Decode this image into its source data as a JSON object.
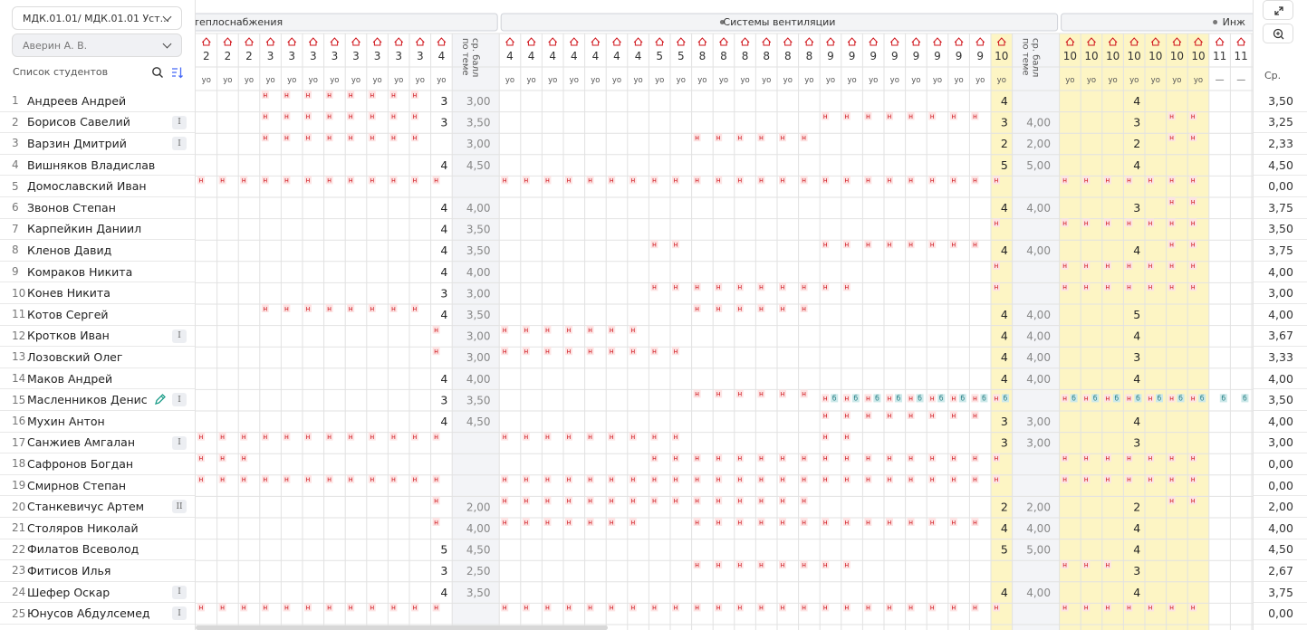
{
  "discipline_select": "МДК.01.01/ МДК.01.01 Уст...",
  "teacher_select": "Аверин А. В.",
  "students_list_title": "Список студентов",
  "average_title": "Ср.",
  "avg_column_label": "ср. балл по теме",
  "mark_absent": "н",
  "mark_sick": "б",
  "lesson_type": "уо",
  "dash": "—",
  "colors": {
    "highlight": "#fdf5c4",
    "absent_bg": "#fde4e4",
    "absent_fg": "#d0141b",
    "sick_bg": "#cde9ea",
    "sick_fg": "#1f7a80",
    "avg_col_bg": "#f3f4f7",
    "grid_line": "#e2e2e2"
  },
  "topics": [
    {
      "title": "темы теплоснабжения",
      "dot": false
    },
    {
      "title": "Системы вентиляции",
      "dot": true
    },
    {
      "title": "Инж",
      "dot": true
    }
  ],
  "columns": [
    "2",
    "2",
    "2",
    "3",
    "3",
    "3",
    "3",
    "3",
    "3",
    "3",
    "3",
    "4",
    "AVG",
    "4",
    "4",
    "4",
    "4",
    "4",
    "4",
    "4",
    "5",
    "5",
    "8",
    "8",
    "8",
    "8",
    "8",
    "8",
    "9",
    "9",
    "9",
    "9",
    "9",
    "9",
    "9",
    "9",
    "10",
    "AVG",
    "10",
    "10",
    "10",
    "10",
    "10",
    "10",
    "10",
    "11",
    "11"
  ],
  "students": [
    {
      "n": "1",
      "name": "Андреев Андрей",
      "badge": "",
      "pen": false,
      "avg": "3,50",
      "t1": {
        "h": "3-10",
        "g": {
          "11": "3"
        },
        "avg": "3,00"
      },
      "t2": {
        "h": "",
        "g": {
          "23": "4"
        },
        "avg": ""
      },
      "t3": {
        "h": "",
        "g": {
          "3": "4"
        }
      }
    },
    {
      "n": "2",
      "name": "Борисов Савелий",
      "badge": "I",
      "pen": false,
      "avg": "3,25",
      "t1": {
        "h": "3-10",
        "g": {
          "11": "3"
        },
        "avg": "3,50"
      },
      "t2": {
        "h": "15-22",
        "g": {
          "23": "3"
        },
        "avg": "4,00"
      },
      "t3": {
        "h": "5-6",
        "g": {
          "3": "3"
        }
      }
    },
    {
      "n": "3",
      "name": "Варзин Дмитрий",
      "badge": "I",
      "pen": false,
      "avg": "2,33",
      "t1": {
        "h": "3-10",
        "g": {},
        "avg": "3,00"
      },
      "t2": {
        "h": "9-14",
        "g": {
          "23": "2"
        },
        "avg": "2,00"
      },
      "t3": {
        "h": "5-6",
        "g": {
          "3": "2"
        }
      }
    },
    {
      "n": "4",
      "name": "Вишняков Владислав",
      "badge": "",
      "pen": false,
      "avg": "4,50",
      "t1": {
        "h": "",
        "g": {
          "11": "4"
        },
        "avg": "4,50"
      },
      "t2": {
        "h": "",
        "g": {
          "23": "5"
        },
        "avg": "5,00"
      },
      "t3": {
        "h": "",
        "g": {
          "3": "4"
        }
      }
    },
    {
      "n": "5",
      "name": "Домославский Иван",
      "badge": "",
      "pen": false,
      "avg": "0,00",
      "t1": {
        "h": "0-11",
        "g": {},
        "avg": ""
      },
      "t2": {
        "h": "0-23",
        "g": {},
        "avg": ""
      },
      "t3": {
        "h": "0-6",
        "g": {}
      }
    },
    {
      "n": "6",
      "name": "Звонов Степан",
      "badge": "",
      "pen": false,
      "avg": "3,75",
      "t1": {
        "h": "",
        "g": {
          "11": "4"
        },
        "avg": "4,00"
      },
      "t2": {
        "h": "",
        "g": {
          "23": "4"
        },
        "avg": "4,00"
      },
      "t3": {
        "h": "5-6",
        "g": {
          "3": "3"
        }
      }
    },
    {
      "n": "7",
      "name": "Карпейкин Даниил",
      "badge": "",
      "pen": false,
      "avg": "3,50",
      "t1": {
        "h": "",
        "g": {
          "11": "4"
        },
        "avg": "3,50"
      },
      "t2": {
        "h": "23",
        "g": {},
        "avg": ""
      },
      "t3": {
        "h": "0-6",
        "g": {}
      }
    },
    {
      "n": "8",
      "name": "Кленов Давид",
      "badge": "",
      "pen": false,
      "avg": "3,75",
      "t1": {
        "h": "",
        "g": {
          "11": "4"
        },
        "avg": "3,50"
      },
      "t2": {
        "h": "7-8,15-22",
        "g": {
          "23": "4"
        },
        "avg": "4,00"
      },
      "t3": {
        "h": "5-6",
        "g": {
          "3": "4"
        }
      }
    },
    {
      "n": "9",
      "name": "Комраков Никита",
      "badge": "",
      "pen": false,
      "avg": "4,00",
      "t1": {
        "h": "",
        "g": {
          "11": "4"
        },
        "avg": "4,00"
      },
      "t2": {
        "h": "23",
        "g": {},
        "avg": ""
      },
      "t3": {
        "h": "0-6",
        "g": {}
      }
    },
    {
      "n": "10",
      "name": "Конев Никита",
      "badge": "",
      "pen": false,
      "avg": "3,00",
      "t1": {
        "h": "",
        "g": {
          "11": "3"
        },
        "avg": "3,00"
      },
      "t2": {
        "h": "7-16,23",
        "g": {},
        "avg": ""
      },
      "t3": {
        "h": "0-6",
        "g": {}
      }
    },
    {
      "n": "11",
      "name": "Котов Сергей",
      "badge": "",
      "pen": false,
      "avg": "4,00",
      "t1": {
        "h": "3-10",
        "g": {
          "11": "4"
        },
        "avg": "3,50"
      },
      "t2": {
        "h": "9-14",
        "g": {
          "23": "4"
        },
        "avg": "4,00"
      },
      "t3": {
        "h": "",
        "g": {
          "3": "5"
        }
      }
    },
    {
      "n": "12",
      "name": "Кротков Иван",
      "badge": "I",
      "pen": false,
      "avg": "3,67",
      "t1": {
        "h": "11",
        "g": {},
        "avg": "3,00"
      },
      "t2": {
        "h": "0-6",
        "g": {
          "23": "4"
        },
        "avg": "4,00"
      },
      "t3": {
        "h": "",
        "g": {
          "3": "4"
        }
      }
    },
    {
      "n": "13",
      "name": "Лозовский Олег",
      "badge": "",
      "pen": false,
      "avg": "3,33",
      "t1": {
        "h": "11",
        "g": {},
        "avg": "3,00"
      },
      "t2": {
        "h": "0-8",
        "g": {
          "23": "4"
        },
        "avg": "4,00"
      },
      "t3": {
        "h": "",
        "g": {
          "3": "3"
        }
      }
    },
    {
      "n": "14",
      "name": "Маков Андрей",
      "badge": "",
      "pen": false,
      "avg": "4,00",
      "t1": {
        "h": "",
        "g": {
          "11": "4"
        },
        "avg": "4,00"
      },
      "t2": {
        "h": "",
        "g": {
          "23": "4"
        },
        "avg": "4,00"
      },
      "t3": {
        "h": "",
        "g": {
          "3": "4"
        }
      }
    },
    {
      "n": "15",
      "name": "Масленников Денис",
      "badge": "I",
      "pen": true,
      "avg": "3,50",
      "t1": {
        "h": "",
        "g": {
          "11": "3"
        },
        "avg": "3,50"
      },
      "t2": {
        "h": "9-14",
        "hb": "15-23",
        "g": {},
        "avg": ""
      },
      "t3": {
        "h": "",
        "hb": "0-6",
        "b": "7-8",
        "g": {}
      }
    },
    {
      "n": "16",
      "name": "Мухин Антон",
      "badge": "",
      "pen": false,
      "avg": "4,00",
      "t1": {
        "h": "",
        "g": {
          "11": "4"
        },
        "avg": "4,50"
      },
      "t2": {
        "h": "15-22",
        "g": {
          "23": "3"
        },
        "avg": "3,00"
      },
      "t3": {
        "h": "",
        "g": {
          "3": "4"
        }
      }
    },
    {
      "n": "17",
      "name": "Санжиев Амгалан",
      "badge": "I",
      "pen": false,
      "avg": "3,00",
      "t1": {
        "h": "0-11",
        "g": {},
        "avg": ""
      },
      "t2": {
        "h": "0-8,15-16",
        "g": {
          "23": "3"
        },
        "avg": "3,00"
      },
      "t3": {
        "h": "",
        "g": {
          "3": "3"
        }
      }
    },
    {
      "n": "18",
      "name": "Сафронов Богдан",
      "badge": "",
      "pen": false,
      "avg": "0,00",
      "t1": {
        "h": "0-2",
        "g": {},
        "avg": ""
      },
      "t2": {
        "h": "7-23",
        "g": {},
        "avg": ""
      },
      "t3": {
        "h": "0-6",
        "g": {}
      }
    },
    {
      "n": "19",
      "name": "Смирнов Степан",
      "badge": "",
      "pen": false,
      "avg": "0,00",
      "t1": {
        "h": "0-11",
        "g": {},
        "avg": ""
      },
      "t2": {
        "h": "0-23",
        "g": {},
        "avg": ""
      },
      "t3": {
        "h": "0-6",
        "g": {}
      }
    },
    {
      "n": "20",
      "name": "Станкевичус Артем",
      "badge": "II",
      "pen": false,
      "avg": "2,00",
      "t1": {
        "h": "11",
        "g": {},
        "avg": "2,00"
      },
      "t2": {
        "h": "0-14",
        "g": {
          "23": "2"
        },
        "avg": "2,00"
      },
      "t3": {
        "h": "5-6",
        "g": {
          "3": "2"
        }
      }
    },
    {
      "n": "21",
      "name": "Столяров Николай",
      "badge": "",
      "pen": false,
      "avg": "4,00",
      "t1": {
        "h": "11",
        "g": {},
        "avg": "4,00"
      },
      "t2": {
        "h": "0-6,9-22",
        "g": {
          "23": "4"
        },
        "avg": "4,00"
      },
      "t3": {
        "h": "",
        "g": {
          "3": "4"
        }
      }
    },
    {
      "n": "22",
      "name": "Филатов Всеволод",
      "badge": "",
      "pen": false,
      "avg": "4,50",
      "t1": {
        "h": "",
        "g": {
          "11": "5"
        },
        "avg": "4,50"
      },
      "t2": {
        "h": "",
        "g": {
          "23": "5"
        },
        "avg": "5,00"
      },
      "t3": {
        "h": "",
        "g": {
          "3": "4"
        }
      }
    },
    {
      "n": "23",
      "name": "Фитисов Илья",
      "badge": "",
      "pen": false,
      "avg": "2,67",
      "t1": {
        "h": "",
        "g": {
          "11": "3"
        },
        "avg": "2,50"
      },
      "t2": {
        "h": "9-16",
        "g": {},
        "avg": ""
      },
      "t3": {
        "h": "0-2",
        "g": {
          "3": "3"
        }
      }
    },
    {
      "n": "24",
      "name": "Шефер Оскар",
      "badge": "I",
      "pen": false,
      "avg": "3,75",
      "t1": {
        "h": "",
        "g": {
          "11": "4"
        },
        "avg": "3,50"
      },
      "t2": {
        "h": "",
        "g": {
          "23": "4"
        },
        "avg": "4,00"
      },
      "t3": {
        "h": "",
        "g": {
          "3": "4"
        }
      }
    },
    {
      "n": "25",
      "name": "Юнусов Абдулсемед",
      "badge": "I",
      "pen": false,
      "avg": "0,00",
      "t1": {
        "h": "0-11",
        "g": {},
        "avg": ""
      },
      "t2": {
        "h": "0-23",
        "g": {},
        "avg": ""
      },
      "t3": {
        "h": "0-6",
        "g": {}
      }
    }
  ]
}
